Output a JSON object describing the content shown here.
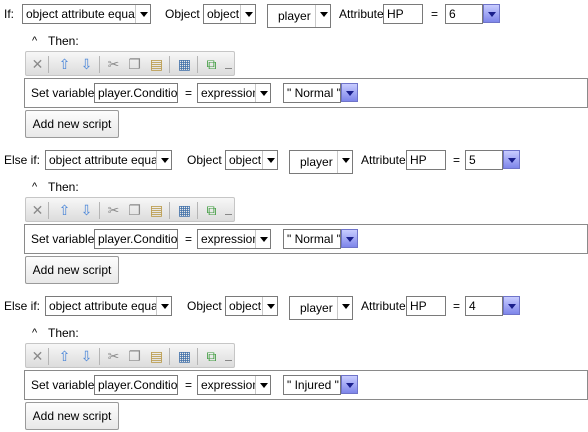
{
  "labels": {
    "if": "If:",
    "else_if": "Else if:",
    "object": "Object",
    "attribute": "Attribute",
    "equals": "=",
    "then": "Then:",
    "caret": "^",
    "set_variable": "Set variable",
    "add_new_script": "Add new script"
  },
  "conditions": [
    {
      "condition_type": "object attribute equals",
      "object_kind": "object",
      "object_name": "player",
      "attribute": "HP",
      "value": "6",
      "variable": "player.Condition",
      "expression_mode": "expression",
      "expression_value": "\" Normal \""
    },
    {
      "condition_type": "object attribute equals",
      "object_kind": "object",
      "object_name": "player",
      "attribute": "HP",
      "value": "5",
      "variable": "player.Condition",
      "expression_mode": "expression",
      "expression_value": "\" Normal \""
    },
    {
      "condition_type": "object attribute equals",
      "object_kind": "object",
      "object_name": "player",
      "attribute": "HP",
      "value": "4",
      "variable": "player.Condition",
      "expression_mode": "expression",
      "expression_value": "\" Injured \""
    }
  ],
  "toolbar_icons": [
    "delete-icon",
    "move-up-icon",
    "move-down-icon",
    "cut-icon",
    "copy-icon",
    "paste-icon",
    "code-view-icon",
    "popout-icon"
  ],
  "colors": {
    "accent_button_top": "#c8ccff",
    "accent_button_bottom": "#7e86ea",
    "toolbar_bg": "#e6e6e6"
  }
}
